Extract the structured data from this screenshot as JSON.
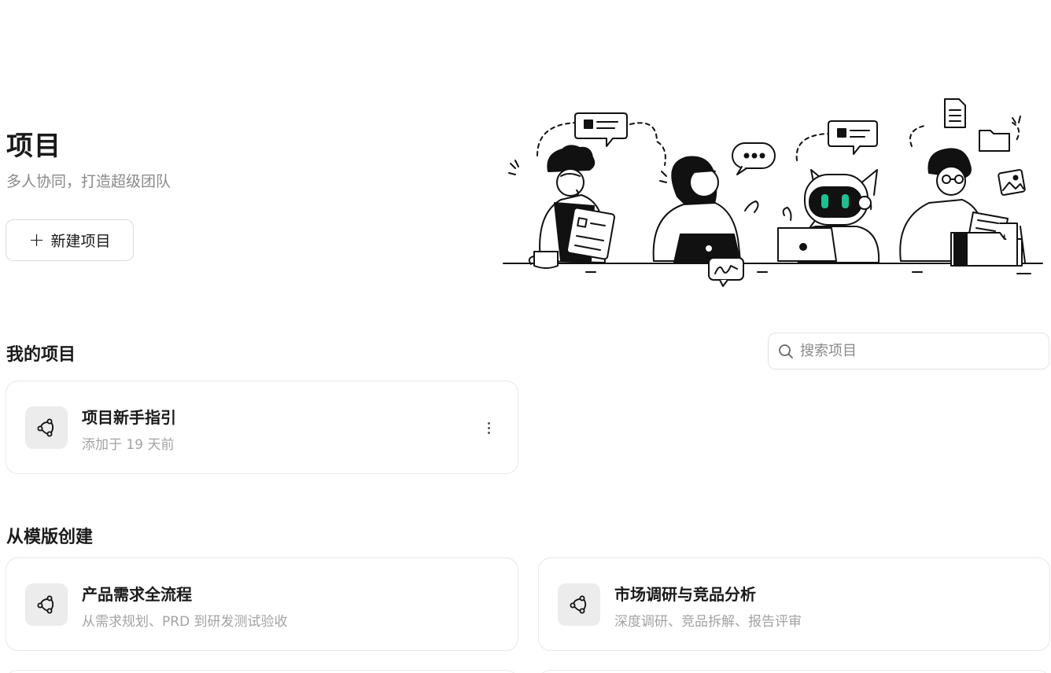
{
  "hero": {
    "title": "项目",
    "subtitle": "多人协同，打造超级团队",
    "new_project_label": "新建项目"
  },
  "my_projects": {
    "title": "我的项目",
    "search_placeholder": "搜索项目",
    "items": [
      {
        "title": "项目新手指引",
        "subtitle": "添加于 19 天前",
        "icon": "project-flow-icon"
      }
    ]
  },
  "templates": {
    "title": "从模版创建",
    "items": [
      {
        "title": "产品需求全流程",
        "subtitle": "从需求规划、PRD 到研发测试验收",
        "icon": "project-flow-icon"
      },
      {
        "title": "市场调研与竞品分析",
        "subtitle": "深度调研、竞品拆解、报告评审",
        "icon": "project-flow-icon"
      }
    ]
  }
}
